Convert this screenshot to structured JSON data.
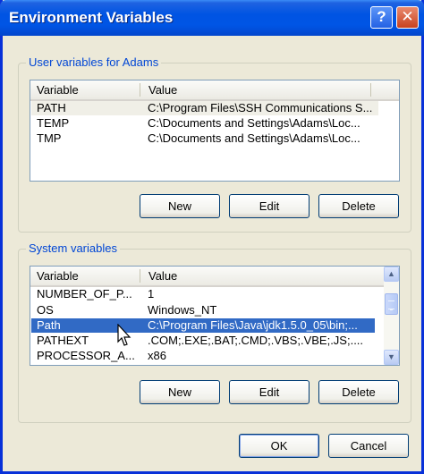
{
  "window": {
    "title": "Environment Variables",
    "help_label": "?",
    "close_label": "✕"
  },
  "user_vars": {
    "group_title": "User variables for Adams",
    "col_variable": "Variable",
    "col_value": "Value",
    "rows": [
      {
        "variable": "PATH",
        "value": "C:\\Program Files\\SSH Communications S..."
      },
      {
        "variable": "TEMP",
        "value": "C:\\Documents and Settings\\Adams\\Loc..."
      },
      {
        "variable": "TMP",
        "value": "C:\\Documents and Settings\\Adams\\Loc..."
      }
    ],
    "new_label": "New",
    "edit_label": "Edit",
    "delete_label": "Delete"
  },
  "system_vars": {
    "group_title": "System variables",
    "col_variable": "Variable",
    "col_value": "Value",
    "rows": [
      {
        "variable": "NUMBER_OF_P...",
        "value": "1"
      },
      {
        "variable": "OS",
        "value": "Windows_NT"
      },
      {
        "variable": "Path",
        "value": "C:\\Program Files\\Java\\jdk1.5.0_05\\bin;..."
      },
      {
        "variable": "PATHEXT",
        "value": ".COM;.EXE;.BAT;.CMD;.VBS;.VBE;.JS;...."
      },
      {
        "variable": "PROCESSOR_A...",
        "value": "x86"
      }
    ],
    "new_label": "New",
    "edit_label": "Edit",
    "delete_label": "Delete"
  },
  "footer": {
    "ok_label": "OK",
    "cancel_label": "Cancel"
  },
  "colors": {
    "titlebar": "#0054e3",
    "selection": "#316ac5",
    "group_title": "#0046d5"
  }
}
